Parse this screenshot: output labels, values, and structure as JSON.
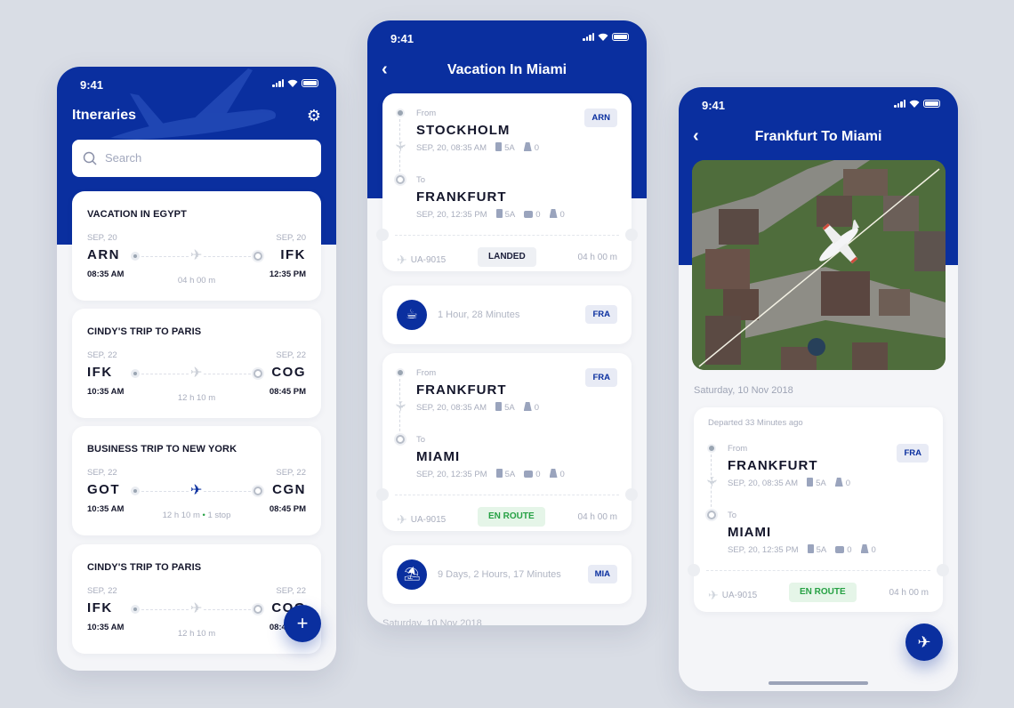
{
  "colors": {
    "brand": "#0a2f9f",
    "background": "#d9dde5",
    "success": "#26a144"
  },
  "status_bar": {
    "time": "9:41"
  },
  "screen1": {
    "title": "Itneraries",
    "search_placeholder": "Search",
    "icons": {
      "settings": "gear-icon",
      "search": "search-icon",
      "fab": "plus-icon"
    },
    "itineraries": [
      {
        "title": "VACATION IN EGYPT",
        "from_date": "SEP, 20",
        "to_date": "SEP, 20",
        "from_code": "ARN",
        "to_code": "IFK",
        "from_time": "08:35 AM",
        "to_time": "12:35 PM",
        "duration": "04 h 00 m",
        "stops": "",
        "active": false
      },
      {
        "title": "CINDY'S TRIP TO PARIS",
        "from_date": "SEP, 22",
        "to_date": "SEP, 22",
        "from_code": "IFK",
        "to_code": "COG",
        "from_time": "10:35 AM",
        "to_time": "08:45 PM",
        "duration": "12 h 10 m",
        "stops": "",
        "active": false
      },
      {
        "title": "BUSINESS TRIP TO NEW YORK",
        "from_date": "SEP, 22",
        "to_date": "SEP, 22",
        "from_code": "GOT",
        "to_code": "CGN",
        "from_time": "10:35 AM",
        "to_time": "08:45 PM",
        "duration": "12 h 10 m",
        "stops": "1 stop",
        "active": true
      },
      {
        "title": "CINDY'S TRIP TO PARIS",
        "from_date": "SEP, 22",
        "to_date": "SEP, 22",
        "from_code": "IFK",
        "to_code": "COG",
        "from_time": "10:35 AM",
        "to_time": "08:45 PM",
        "duration": "12 h 10 m",
        "stops": "",
        "active": false
      }
    ]
  },
  "screen2": {
    "title": "Vacation In Miami",
    "flight1": {
      "from_label": "From",
      "from_city": "STOCKHOLM",
      "from_meta": "SEP, 20, 08:35 AM",
      "from_gate": "5A",
      "from_road": "0",
      "badge": "ARN",
      "to_label": "To",
      "to_city": "FRANKFURT",
      "to_meta": "SEP, 20, 12:35 PM",
      "to_gate": "5A",
      "to_bag": "0",
      "to_road": "0",
      "flight_no": "UA-9015",
      "status": "LANDED",
      "duration": "04 h 00 m"
    },
    "layover1": {
      "text": "1 Hour, 28 Minutes",
      "badge": "FRA",
      "icon": "coffee-icon"
    },
    "flight2": {
      "from_label": "From",
      "from_city": "FRANKFURT",
      "from_meta": "SEP, 20, 08:35 AM",
      "from_gate": "5A",
      "from_road": "0",
      "badge": "FRA",
      "to_label": "To",
      "to_city": "MIAMI",
      "to_meta": "SEP, 20, 12:35 PM",
      "to_gate": "5A",
      "to_bag": "0",
      "to_road": "0",
      "flight_no": "UA-9015",
      "status": "EN ROUTE",
      "duration": "04 h 00 m"
    },
    "layover2": {
      "text": "9 Days, 2 Hours, 17 Minutes",
      "badge": "MIA",
      "icon": "beach-icon"
    },
    "footer_date": "Saturday, 10 Nov 2018"
  },
  "screen3": {
    "title": "Frankfurt To Miami",
    "date": "Saturday, 10 Nov 2018",
    "departed": "Departed 33 Minutes ago",
    "flight": {
      "from_label": "From",
      "from_city": "FRANKFURT",
      "from_meta": "SEP, 20, 08:35 AM",
      "from_gate": "5A",
      "from_road": "0",
      "badge": "FRA",
      "to_label": "To",
      "to_city": "MIAMI",
      "to_meta": "SEP, 20, 12:35 PM",
      "to_gate": "5A",
      "to_bag": "0",
      "to_road": "0",
      "flight_no": "UA-9015",
      "status": "EN ROUTE",
      "duration": "04 h 00 m"
    }
  }
}
